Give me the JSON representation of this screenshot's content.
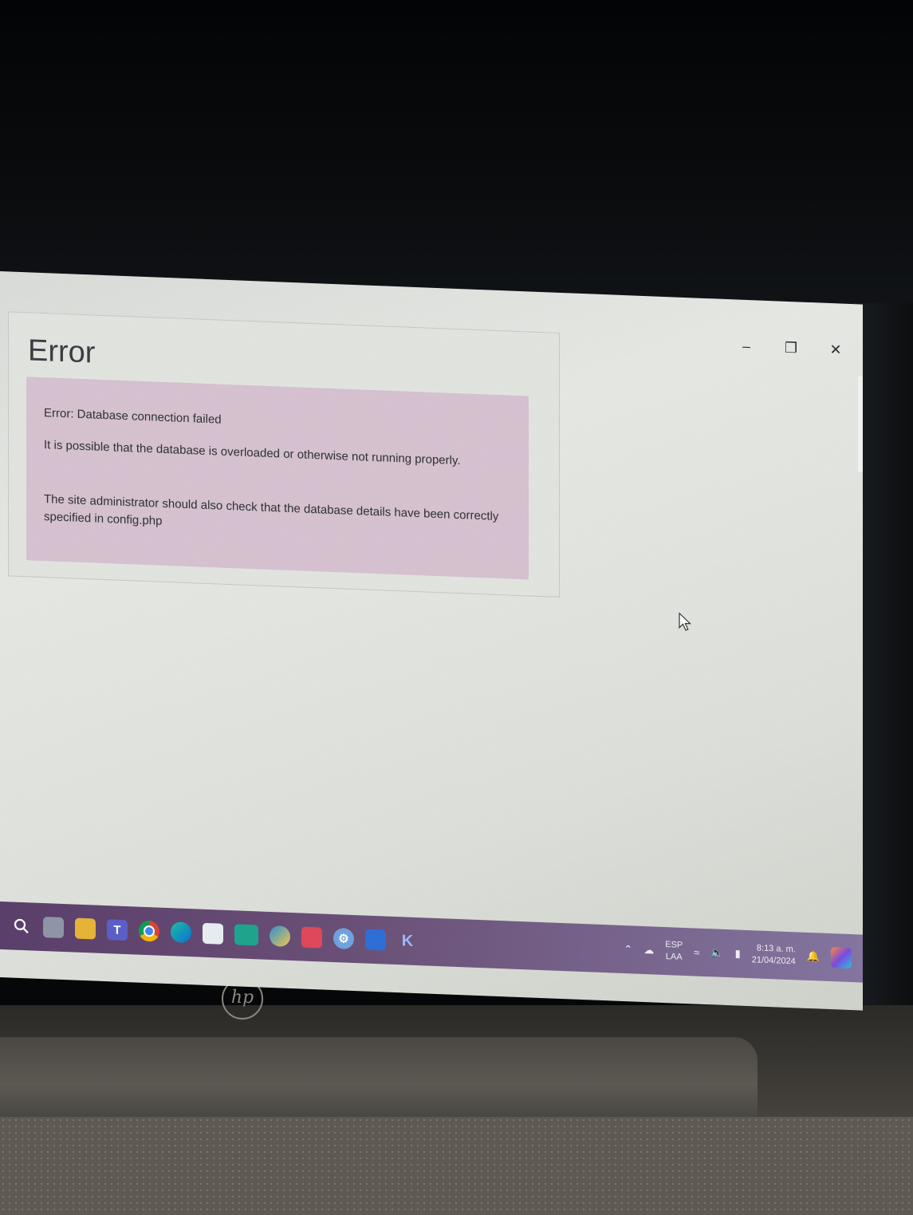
{
  "window": {
    "minimize_icon": "minimize-icon",
    "restore_icon": "restore-icon",
    "close_icon": "close-icon"
  },
  "error_panel": {
    "title": "Error",
    "message": "Error: Database connection failed",
    "detail_1": "It is possible that the database is overloaded or otherwise not running properly.",
    "detail_2": "The site administrator should also check that the database details have been correctly specified in config.php"
  },
  "taskbar": {
    "apps": [
      "search-icon",
      "task-view-icon",
      "file-explorer-icon",
      "teams-icon",
      "chrome-icon",
      "edge-icon",
      "store-icon",
      "app-green-icon",
      "app-globe-icon",
      "app-red-icon",
      "settings-icon",
      "app-blue-icon",
      "app-k-icon"
    ],
    "tray": {
      "language": "ESP",
      "layout": "LAA",
      "time": "8:13 a. m.",
      "date": "21/04/2024"
    }
  },
  "hardware": {
    "brand": "hp"
  }
}
